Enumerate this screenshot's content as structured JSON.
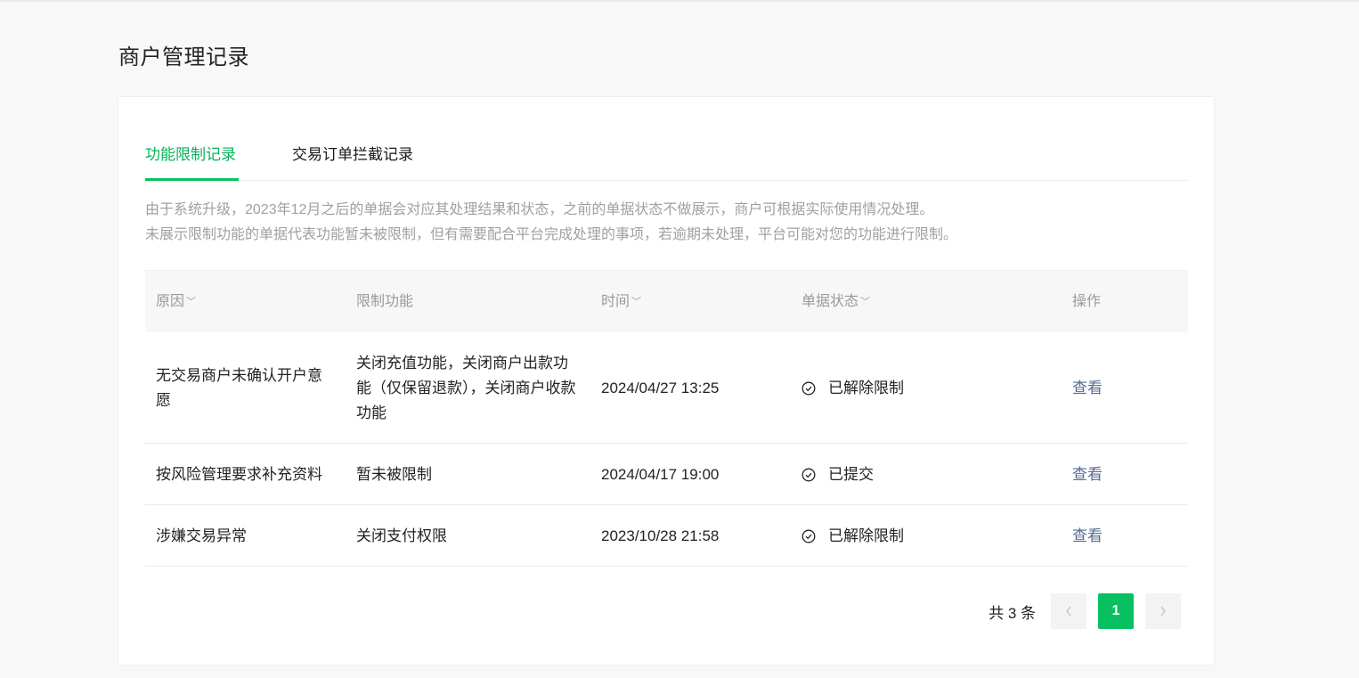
{
  "page": {
    "title": "商户管理记录"
  },
  "tabs": [
    {
      "label": "功能限制记录",
      "active": true
    },
    {
      "label": "交易订单拦截记录",
      "active": false
    }
  ],
  "notice": {
    "line1": "由于系统升级，2023年12月之后的单据会对应其处理结果和状态，之前的单据状态不做展示，商户可根据实际使用情况处理。",
    "line2": "未展示限制功能的单据代表功能暂未被限制，但有需要配合平台完成处理的事项，若逾期未处理，平台可能对您的功能进行限制。"
  },
  "table": {
    "headers": {
      "reason": "原因",
      "function": "限制功能",
      "time": "时间",
      "status": "单据状态",
      "action": "操作"
    },
    "rows": [
      {
        "reason": "无交易商户未确认开户意愿",
        "function": "关闭充值功能，关闭商户出款功能（仅保留退款），关闭商户收款功能",
        "time": "2024/04/27 13:25",
        "status": "已解除限制",
        "action": "查看"
      },
      {
        "reason": "按风险管理要求补充资料",
        "function": "暂未被限制",
        "time": "2024/04/17 19:00",
        "status": "已提交",
        "action": "查看"
      },
      {
        "reason": "涉嫌交易异常",
        "function": "关闭支付权限",
        "time": "2023/10/28 21:58",
        "status": "已解除限制",
        "action": "查看"
      }
    ]
  },
  "pagination": {
    "total_text": "共 3 条",
    "current_page": "1",
    "prev_icon": "chevron-left-icon",
    "next_icon": "chevron-right-icon"
  },
  "colors": {
    "accent": "#07c160",
    "link": "#576b95"
  }
}
